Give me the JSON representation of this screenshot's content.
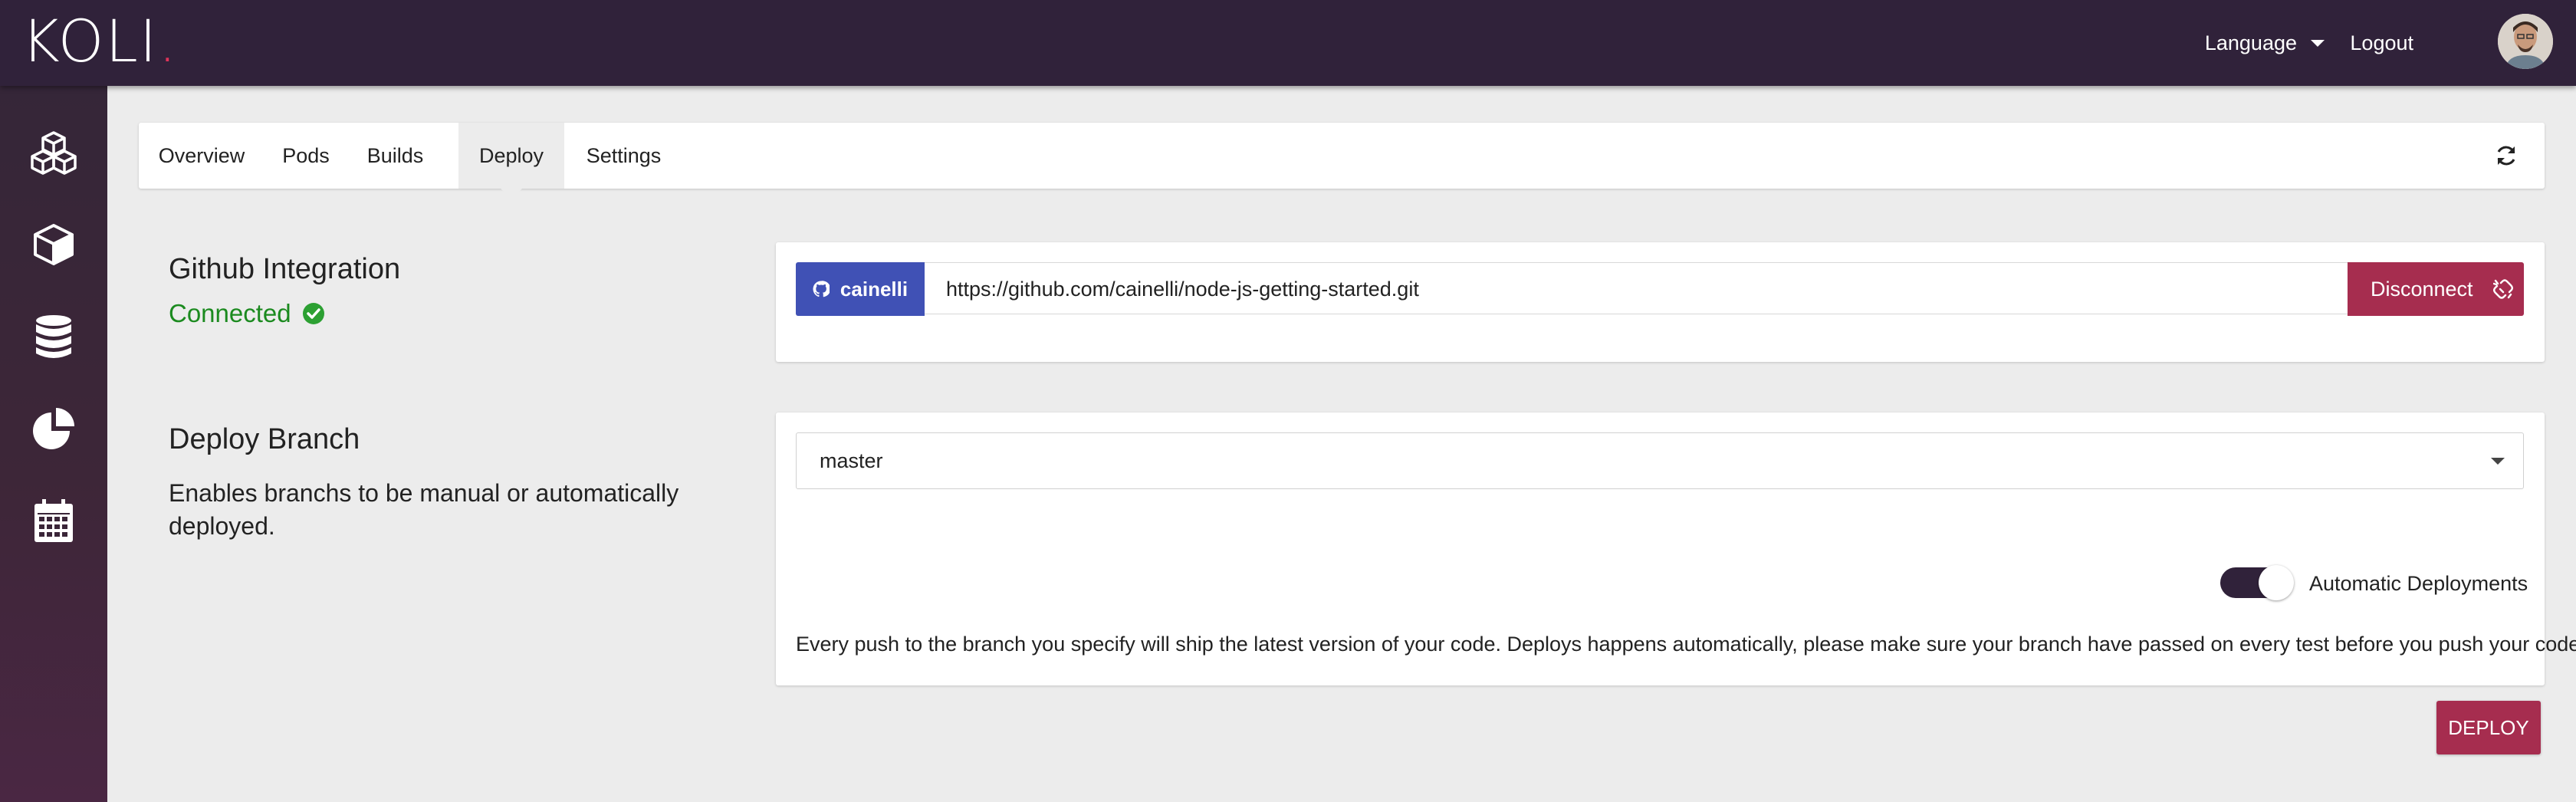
{
  "header": {
    "logo_text": "KOLI",
    "logo_dot": ".",
    "language_label": "Language",
    "logout_label": "Logout",
    "avatar_icon": "user-avatar"
  },
  "sidebar": {
    "items": [
      {
        "icon": "cubes-icon"
      },
      {
        "icon": "cube-icon"
      },
      {
        "icon": "database-icon"
      },
      {
        "icon": "pie-chart-icon"
      },
      {
        "icon": "calendar-icon"
      }
    ]
  },
  "tabs": {
    "items": [
      {
        "label": "Overview"
      },
      {
        "label": "Pods"
      },
      {
        "label": "Builds"
      },
      {
        "label": "Deploy",
        "active": true
      },
      {
        "label": "Settings"
      }
    ],
    "refresh_icon": "refresh-icon"
  },
  "github": {
    "title": "Github Integration",
    "status": "Connected",
    "status_color": "#1b8a1f",
    "username": "cainelli",
    "repo_url": "https://github.com/cainelli/node-js-getting-started.git",
    "disconnect_label": "Disconnect",
    "badge_color": "#4051b5",
    "disconnect_color": "#a62d4f"
  },
  "deploy": {
    "title": "Deploy Branch",
    "description": "Enables branchs to be manual or automatically deployed.",
    "branch": "master",
    "auto_label": "Automatic Deployments",
    "auto_enabled": true,
    "note": "Every push to the branch you specify will ship the latest version of your code. Deploys happens automatically, please make sure your branch have passed on every test before you push your code.",
    "deploy_label": "DEPLOY"
  },
  "colors": {
    "topbar": "#30223a",
    "accent": "#a62d4f",
    "background": "#ececec"
  }
}
